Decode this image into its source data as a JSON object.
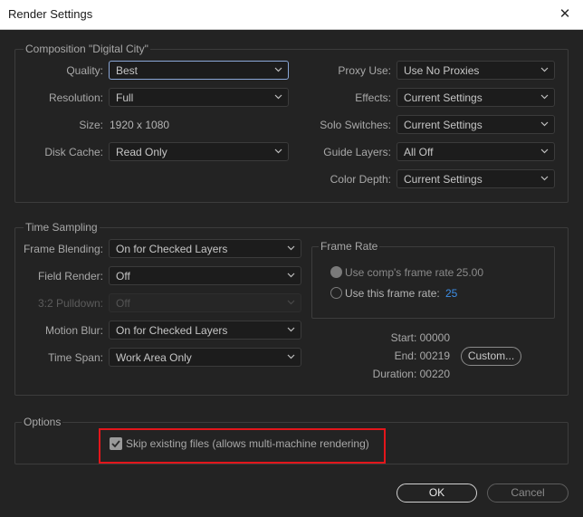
{
  "window": {
    "title": "Render Settings",
    "close_glyph": "✕"
  },
  "composition": {
    "group_label": "Composition \"Digital City\"",
    "quality": {
      "label": "Quality:",
      "value": "Best"
    },
    "resolution": {
      "label": "Resolution:",
      "value": "Full"
    },
    "size": {
      "label": "Size:",
      "value": "1920 x 1080"
    },
    "disk_cache": {
      "label": "Disk Cache:",
      "value": "Read Only"
    },
    "proxy_use": {
      "label": "Proxy Use:",
      "value": "Use No Proxies"
    },
    "effects": {
      "label": "Effects:",
      "value": "Current Settings"
    },
    "solo_switches": {
      "label": "Solo Switches:",
      "value": "Current Settings"
    },
    "guide_layers": {
      "label": "Guide Layers:",
      "value": "All Off"
    },
    "color_depth": {
      "label": "Color Depth:",
      "value": "Current Settings"
    }
  },
  "time_sampling": {
    "group_label": "Time Sampling",
    "frame_blending": {
      "label": "Frame Blending:",
      "value": "On for Checked Layers"
    },
    "field_render": {
      "label": "Field Render:",
      "value": "Off"
    },
    "pulldown": {
      "label": "3:2 Pulldown:",
      "value": "Off"
    },
    "motion_blur": {
      "label": "Motion Blur:",
      "value": "On for Checked Layers"
    },
    "time_span": {
      "label": "Time Span:",
      "value": "Work Area Only"
    },
    "frame_rate": {
      "group_label": "Frame Rate",
      "use_comp_label": "Use comp's frame rate",
      "use_comp_value": "25.00",
      "use_this_label": "Use this frame rate:",
      "use_this_value": "25"
    },
    "start": "Start: 00000",
    "end": "End: 00219",
    "duration": "Duration: 00220",
    "custom_button": "Custom..."
  },
  "options": {
    "group_label": "Options",
    "skip_existing": "Skip existing files (allows multi-machine rendering)",
    "skip_existing_checked": true
  },
  "footer": {
    "ok": "OK",
    "cancel": "Cancel"
  },
  "colors": {
    "background": "#232323",
    "highlight": "#e3161b",
    "accent": "#3d8ee6"
  }
}
